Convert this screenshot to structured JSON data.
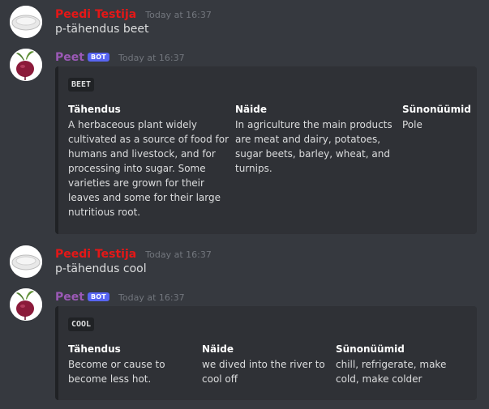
{
  "messages": [
    {
      "author": "Peedi Testija",
      "timestamp": "Today at 16:37",
      "text": "p-tähendus beet"
    },
    {
      "author": "Peet",
      "badge": "BOT",
      "timestamp": "Today at 16:37",
      "embed": {
        "title": "BEET",
        "fields": [
          {
            "name": "Tähendus",
            "value_lines": [
              "A herbaceous plant widely",
              "cultivated as a source of food for",
              "humans and livestock, and for",
              "processing into sugar. Some",
              "varieties are grown for their",
              "leaves and some for their large",
              "nutritious root."
            ]
          },
          {
            "name": "Näide",
            "value_lines": [
              "In agriculture the main products",
              "are meat and dairy, potatoes,",
              "sugar beets, barley, wheat, and",
              "turnips."
            ]
          },
          {
            "name": "Sünonüümid",
            "value_lines": [
              "Pole"
            ]
          }
        ]
      }
    },
    {
      "author": "Peedi Testija",
      "timestamp": "Today at 16:37",
      "text": "p-tähendus cool"
    },
    {
      "author": "Peet",
      "badge": "BOT",
      "timestamp": "Today at 16:37",
      "embed": {
        "title": "COOL",
        "fields": [
          {
            "name": "Tähendus",
            "value_lines": [
              "Become or cause to",
              "become less hot."
            ]
          },
          {
            "name": "Näide",
            "value_lines": [
              "we dived into the river to",
              "cool off"
            ]
          },
          {
            "name": "Sünonüümid",
            "value_lines": [
              "chill, refrigerate, make",
              "cold, make colder"
            ]
          }
        ]
      }
    }
  ],
  "colors": {
    "background": "#36393f",
    "embed_background": "#2f3136",
    "user_name": "#e51717",
    "bot_name": "#9b59b6",
    "bot_badge": "#5865f2"
  },
  "icons": {
    "user_avatar": "plate-avatar-icon",
    "bot_avatar": "beet-avatar-icon"
  }
}
